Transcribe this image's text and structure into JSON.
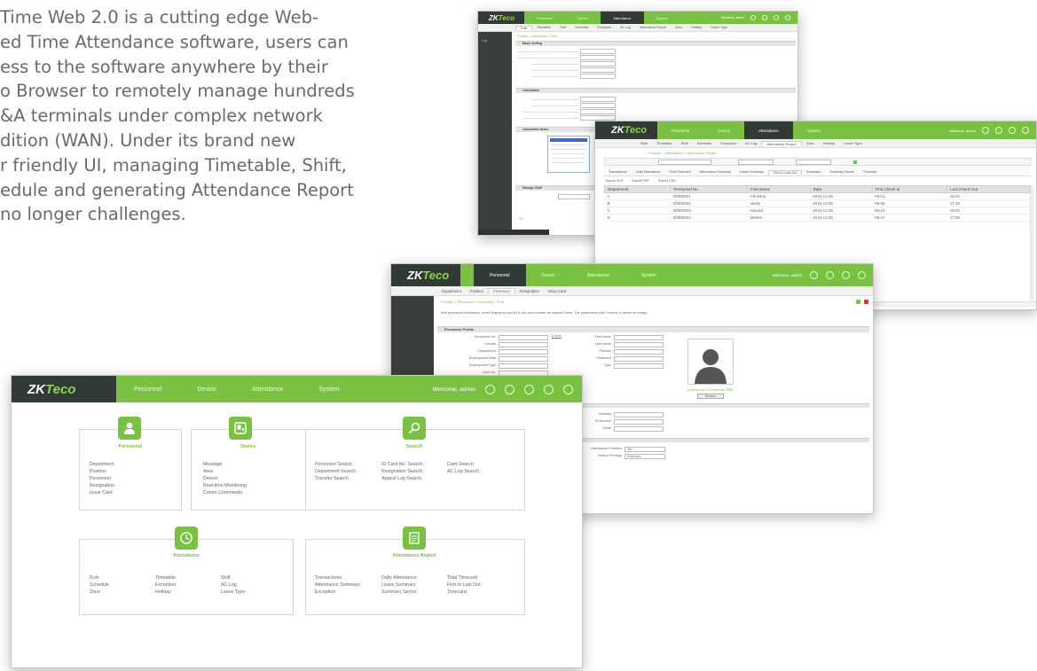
{
  "intro": {
    "lines": [
      "Time Web 2.0 is a cutting edge Web-",
      "ed Time Attendance software, users can",
      "ess to the software anywhere by their",
      "o Browser to remotely manage hundreds",
      "&A terminals under complex network",
      "dition (WAN). Under its brand new",
      "r friendly UI, managing Timetable, Shift,",
      "edule and generating Attendance Report",
      "no longer challenges."
    ]
  },
  "brand": {
    "logo_main": "ZK",
    "logo_sub": "Teco",
    "accent": "#7ac143",
    "dark": "#323a36"
  },
  "nav": {
    "personnel": "Personnel",
    "device": "Device",
    "attendance": "Attendance",
    "system": "System",
    "welcome": "Welcome, admin"
  },
  "timetable_shot": {
    "tabs": [
      "Rule",
      "Timetable",
      "Shift",
      "Schedule",
      "Exception",
      "AC Log",
      "Attendance Report",
      "Zone",
      "Holiday",
      "Leave Type"
    ],
    "crumb": "Position > Attendance > Rule",
    "sections": [
      "Basic Setting",
      "Calculation",
      "Calculation Items",
      "Manage Shift"
    ],
    "side_label": "Log",
    "ok": "OK"
  },
  "report_shot": {
    "tabs": [
      "Rule",
      "Timetable",
      "Shift",
      "Schedule",
      "Exception",
      "AC Log",
      "Attendance Report",
      "Zone",
      "Holiday",
      "Leave Type"
    ],
    "crumb": "Position > Attendance > Attendance Report",
    "subtabs": [
      "Transactions",
      "Daily Attendance",
      "Total Timecard",
      "Attendance Summary",
      "Leave Summary",
      "First In Last Out",
      "Exception",
      "Summary Sector",
      "Timecard"
    ],
    "export": [
      "Export XLS",
      "Export PDF",
      "Export CSV"
    ],
    "columns": [
      "Department",
      "Personnel No.",
      "First Name",
      "Date",
      "First Check In",
      "Last Check Out"
    ],
    "rows": [
      [
        "A",
        "00000001",
        "Christina",
        "2015-11-05",
        "09:01",
        "18:02"
      ],
      [
        "B",
        "00000002",
        "Vasily",
        "2015-11-05",
        "08:58",
        "17:45"
      ],
      [
        "C",
        "00000003",
        "Nomad",
        "2015-11-05",
        "09:10",
        "18:01"
      ],
      [
        "D",
        "00000004",
        "Marlen",
        "2015-11-05",
        "08:47",
        "17:58"
      ]
    ]
  },
  "personnel_shot": {
    "tabs": [
      "Department",
      "Position",
      "Personnel",
      "Resignation",
      "Issue Card"
    ],
    "crumb": "Position > Personnel > Personnel > Edit",
    "notice": "Add personnel information, enroll fingerprint and fill in the card number as required there. The parameters with * means it cannot be empty.",
    "section": "Personnel Profile",
    "left_fields": [
      "Personnel No.",
      "Gender",
      "Department",
      "Employment Date",
      "Employment Type",
      "Card No."
    ],
    "right_fields": [
      "First Name",
      "Last Name",
      "Position",
      "Password",
      "Type"
    ],
    "check": "Check",
    "photo_hint": "(Optimal size 3:4, less than 3MB)",
    "browse": "Browse",
    "contact_fields": [
      "Birthday",
      "ID Number",
      "Email"
    ],
    "device_fields": [
      "Attendance Function",
      "Device Privilege"
    ],
    "device_values": [
      "Yes",
      "Employee"
    ]
  },
  "home": {
    "cards": [
      {
        "title": "Personnel",
        "icon": "person-icon",
        "items": [
          [
            "Department",
            "Position",
            "Personnel",
            "Resignation",
            "Issue Card"
          ]
        ]
      },
      {
        "title": "Device",
        "icon": "device-icon",
        "items": [
          [
            "Message",
            "Area",
            "Device",
            "Real-time Monitoring",
            "Comm Commands"
          ]
        ]
      },
      {
        "title": "Search",
        "icon": "search-icon",
        "items": [
          [
            "Personnel Search",
            "Department Search",
            "Transfer Search"
          ],
          [
            "ID Card No. Search",
            "Resignation Search",
            "Appeal Log Search"
          ],
          [
            "Card Search",
            "AC Log Search"
          ]
        ]
      },
      {
        "title": "Attendance",
        "icon": "clock-icon",
        "items": [
          [
            "Rule",
            "Schedule",
            "Zone"
          ],
          [
            "Timetable",
            "Exception",
            "Holiday"
          ],
          [
            "Shift",
            "AC Log",
            "Leave Type"
          ]
        ]
      },
      {
        "title": "Attendance Report",
        "icon": "report-icon",
        "items": [
          [
            "Transactions",
            "Attendance Summary",
            "Exception"
          ],
          [
            "Daily Attendance",
            "Leave Summary",
            "Summary Sector"
          ],
          [
            "Total Timecard",
            "First In Last Out",
            "Timecard"
          ]
        ]
      }
    ]
  }
}
